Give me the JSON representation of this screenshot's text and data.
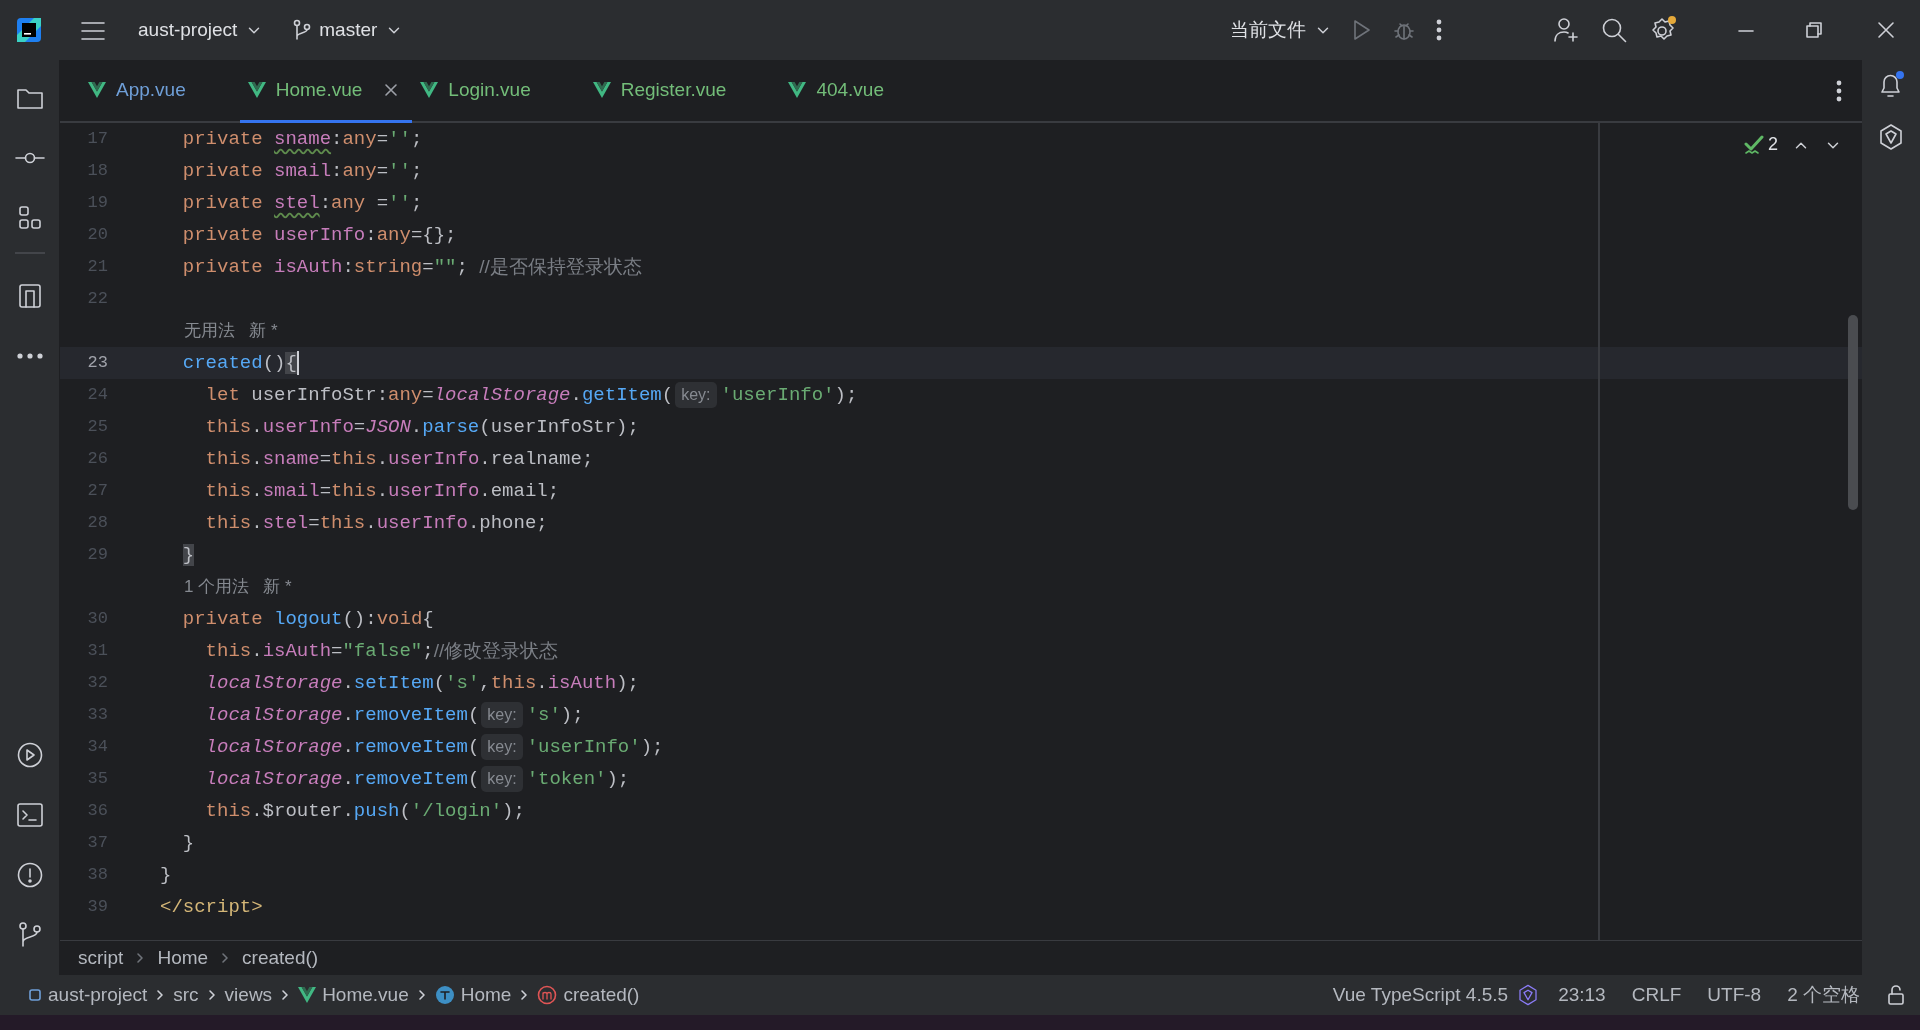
{
  "title_bar": {
    "project": "aust-project",
    "branch": "master",
    "run_config": "当前文件"
  },
  "tabs": [
    {
      "label": "App.vue",
      "selected": false,
      "color": "#6f9fd8"
    },
    {
      "label": "Home.vue",
      "selected": true,
      "color": "#73bd79"
    },
    {
      "label": "Login.vue",
      "selected": false,
      "color": "#73bd79"
    },
    {
      "label": "Register.vue",
      "selected": false,
      "color": "#73bd79"
    },
    {
      "label": "404.vue",
      "selected": false,
      "color": "#73bd79"
    }
  ],
  "editor": {
    "inspection_count": "2",
    "lines": [
      {
        "kind": "code",
        "number": "17",
        "current": false,
        "tokens": [
          {
            "kind": "kw",
            "text": "  private "
          },
          {
            "kind": "fieldw",
            "text": "sname"
          },
          {
            "kind": "plain",
            "text": ":"
          },
          {
            "kind": "kw",
            "text": "any"
          },
          {
            "kind": "plain",
            "text": "="
          },
          {
            "kind": "str",
            "text": "''"
          },
          {
            "kind": "plain",
            "text": ";"
          }
        ]
      },
      {
        "kind": "code",
        "number": "18",
        "current": false,
        "tokens": [
          {
            "kind": "kw",
            "text": "  private "
          },
          {
            "kind": "field",
            "text": "smail"
          },
          {
            "kind": "plain",
            "text": ":"
          },
          {
            "kind": "kw",
            "text": "any"
          },
          {
            "kind": "plain",
            "text": "="
          },
          {
            "kind": "str",
            "text": "''"
          },
          {
            "kind": "plain",
            "text": ";"
          }
        ]
      },
      {
        "kind": "code",
        "number": "19",
        "current": false,
        "tokens": [
          {
            "kind": "kw",
            "text": "  private "
          },
          {
            "kind": "fieldw",
            "text": "stel"
          },
          {
            "kind": "plain",
            "text": ":"
          },
          {
            "kind": "kw",
            "text": "any"
          },
          {
            "kind": "plain",
            "text": " ="
          },
          {
            "kind": "str",
            "text": "''"
          },
          {
            "kind": "plain",
            "text": ";"
          }
        ]
      },
      {
        "kind": "code",
        "number": "20",
        "current": false,
        "tokens": [
          {
            "kind": "kw",
            "text": "  private "
          },
          {
            "kind": "field",
            "text": "userInfo"
          },
          {
            "kind": "plain",
            "text": ":"
          },
          {
            "kind": "kw",
            "text": "any"
          },
          {
            "kind": "plain",
            "text": "={};"
          }
        ]
      },
      {
        "kind": "code",
        "number": "21",
        "current": false,
        "tokens": [
          {
            "kind": "kw",
            "text": "  private "
          },
          {
            "kind": "field",
            "text": "isAuth"
          },
          {
            "kind": "plain",
            "text": ":"
          },
          {
            "kind": "kw",
            "text": "string"
          },
          {
            "kind": "plain",
            "text": "="
          },
          {
            "kind": "str",
            "text": "\"\""
          },
          {
            "kind": "plain",
            "text": "; "
          },
          {
            "kind": "cmt",
            "text": "//是否保持登录状态"
          }
        ]
      },
      {
        "kind": "code",
        "number": "22",
        "current": false
      },
      {
        "kind": "lens",
        "text": "无用法   新 *"
      },
      {
        "kind": "code",
        "number": "23",
        "current": true,
        "tokens": [
          {
            "kind": "fn",
            "text": "  created"
          },
          {
            "kind": "plain",
            "text": "()"
          },
          {
            "kind": "brace",
            "text": "{"
          }
        ]
      },
      {
        "kind": "code",
        "number": "24",
        "current": false,
        "tokens": [
          {
            "kind": "kw",
            "text": "    let"
          },
          {
            "kind": "plain",
            "text": " userInfoStr:"
          },
          {
            "kind": "kw",
            "text": "any"
          },
          {
            "kind": "plain",
            "text": "="
          },
          {
            "kind": "glob",
            "text": "localStorage"
          },
          {
            "kind": "plain",
            "text": "."
          },
          {
            "kind": "fn",
            "text": "getItem"
          },
          {
            "kind": "plain",
            "text": "("
          },
          {
            "kind": "hint",
            "text": "key:"
          },
          {
            "kind": "str",
            "text": "'userInfo'"
          },
          {
            "kind": "plain",
            "text": ");"
          }
        ]
      },
      {
        "kind": "code",
        "number": "25",
        "current": false,
        "tokens": [
          {
            "kind": "kw",
            "text": "    this"
          },
          {
            "kind": "plain",
            "text": "."
          },
          {
            "kind": "field",
            "text": "userInfo"
          },
          {
            "kind": "plain",
            "text": "="
          },
          {
            "kind": "glob",
            "text": "JSON"
          },
          {
            "kind": "plain",
            "text": "."
          },
          {
            "kind": "fn",
            "text": "parse"
          },
          {
            "kind": "plain",
            "text": "(userInfoStr);"
          }
        ]
      },
      {
        "kind": "code",
        "number": "26",
        "current": false,
        "tokens": [
          {
            "kind": "kw",
            "text": "    this"
          },
          {
            "kind": "plain",
            "text": "."
          },
          {
            "kind": "field",
            "text": "sname"
          },
          {
            "kind": "plain",
            "text": "="
          },
          {
            "kind": "kw",
            "text": "this"
          },
          {
            "kind": "plain",
            "text": "."
          },
          {
            "kind": "field",
            "text": "userInfo"
          },
          {
            "kind": "plain",
            "text": ".realname;"
          }
        ]
      },
      {
        "kind": "code",
        "number": "27",
        "current": false,
        "tokens": [
          {
            "kind": "kw",
            "text": "    this"
          },
          {
            "kind": "plain",
            "text": "."
          },
          {
            "kind": "field",
            "text": "smail"
          },
          {
            "kind": "plain",
            "text": "="
          },
          {
            "kind": "kw",
            "text": "this"
          },
          {
            "kind": "plain",
            "text": "."
          },
          {
            "kind": "field",
            "text": "userInfo"
          },
          {
            "kind": "plain",
            "text": ".email;"
          }
        ]
      },
      {
        "kind": "code",
        "number": "28",
        "current": false,
        "tokens": [
          {
            "kind": "kw",
            "text": "    this"
          },
          {
            "kind": "plain",
            "text": "."
          },
          {
            "kind": "field",
            "text": "stel"
          },
          {
            "kind": "plain",
            "text": "="
          },
          {
            "kind": "kw",
            "text": "this"
          },
          {
            "kind": "plain",
            "text": "."
          },
          {
            "kind": "field",
            "text": "userInfo"
          },
          {
            "kind": "plain",
            "text": ".phone;"
          }
        ]
      },
      {
        "kind": "code",
        "number": "29",
        "current": false,
        "tokens": [
          {
            "kind": "brace",
            "text": "  }"
          }
        ]
      },
      {
        "kind": "lens",
        "text": "1 个用法   新 *"
      },
      {
        "kind": "code",
        "number": "30",
        "current": false,
        "tokens": [
          {
            "kind": "kw",
            "text": "  private "
          },
          {
            "kind": "fn",
            "text": "logout"
          },
          {
            "kind": "plain",
            "text": "():"
          },
          {
            "kind": "kw",
            "text": "void"
          },
          {
            "kind": "plain",
            "text": "{"
          }
        ]
      },
      {
        "kind": "code",
        "number": "31",
        "current": false,
        "tokens": [
          {
            "kind": "kw",
            "text": "    this"
          },
          {
            "kind": "plain",
            "text": "."
          },
          {
            "kind": "field",
            "text": "isAuth"
          },
          {
            "kind": "plain",
            "text": "="
          },
          {
            "kind": "str",
            "text": "\"false\""
          },
          {
            "kind": "plain",
            "text": ";"
          },
          {
            "kind": "cmt",
            "text": "//修改登录状态"
          }
        ]
      },
      {
        "kind": "code",
        "number": "32",
        "current": false,
        "tokens": [
          {
            "kind": "glob",
            "text": "    localStorage"
          },
          {
            "kind": "plain",
            "text": "."
          },
          {
            "kind": "fn",
            "text": "setItem"
          },
          {
            "kind": "plain",
            "text": "("
          },
          {
            "kind": "str",
            "text": "'s'"
          },
          {
            "kind": "plain",
            "text": ","
          },
          {
            "kind": "kw",
            "text": "this"
          },
          {
            "kind": "plain",
            "text": "."
          },
          {
            "kind": "field",
            "text": "isAuth"
          },
          {
            "kind": "plain",
            "text": ");"
          }
        ]
      },
      {
        "kind": "code",
        "number": "33",
        "current": false,
        "tokens": [
          {
            "kind": "glob",
            "text": "    localStorage"
          },
          {
            "kind": "plain",
            "text": "."
          },
          {
            "kind": "fn",
            "text": "removeItem"
          },
          {
            "kind": "plain",
            "text": "("
          },
          {
            "kind": "hint",
            "text": "key:"
          },
          {
            "kind": "str",
            "text": "'s'"
          },
          {
            "kind": "plain",
            "text": ");"
          }
        ]
      },
      {
        "kind": "code",
        "number": "34",
        "current": false,
        "tokens": [
          {
            "kind": "glob",
            "text": "    localStorage"
          },
          {
            "kind": "plain",
            "text": "."
          },
          {
            "kind": "fn",
            "text": "removeItem"
          },
          {
            "kind": "plain",
            "text": "("
          },
          {
            "kind": "hint",
            "text": "key:"
          },
          {
            "kind": "str",
            "text": "'userInfo'"
          },
          {
            "kind": "plain",
            "text": ");"
          }
        ]
      },
      {
        "kind": "code",
        "number": "35",
        "current": false,
        "tokens": [
          {
            "kind": "glob",
            "text": "    localStorage"
          },
          {
            "kind": "plain",
            "text": "."
          },
          {
            "kind": "fn",
            "text": "removeItem"
          },
          {
            "kind": "plain",
            "text": "("
          },
          {
            "kind": "hint",
            "text": "key:"
          },
          {
            "kind": "str",
            "text": "'token'"
          },
          {
            "kind": "plain",
            "text": ");"
          }
        ]
      },
      {
        "kind": "code",
        "number": "36",
        "current": false,
        "tokens": [
          {
            "kind": "kw",
            "text": "    this"
          },
          {
            "kind": "plain",
            "text": ".$router."
          },
          {
            "kind": "fn",
            "text": "push"
          },
          {
            "kind": "plain",
            "text": "("
          },
          {
            "kind": "str",
            "text": "'/login'"
          },
          {
            "kind": "plain",
            "text": ");"
          }
        ]
      },
      {
        "kind": "code",
        "number": "37",
        "current": false,
        "tokens": [
          {
            "kind": "plain",
            "text": "  }"
          }
        ]
      },
      {
        "kind": "code",
        "number": "38",
        "current": false,
        "tokens": [
          {
            "kind": "plain",
            "text": "}"
          }
        ]
      },
      {
        "kind": "code",
        "number": "39",
        "current": false,
        "tokens": [
          {
            "kind": "tag",
            "text": "</script>"
          }
        ]
      }
    ]
  },
  "breadcrumbs": [
    "script",
    "Home",
    "created()"
  ],
  "status_bar": {
    "path": [
      {
        "kind": "project",
        "label": "aust-project"
      },
      {
        "kind": "folder",
        "label": "src"
      },
      {
        "kind": "folder",
        "label": "views"
      },
      {
        "kind": "vue",
        "label": "Home.vue"
      },
      {
        "kind": "class",
        "label": "Home"
      },
      {
        "kind": "method",
        "label": "created()"
      }
    ],
    "language": "Vue TypeScript 4.5.5",
    "position": "23:13",
    "line_ending": "CRLF",
    "encoding": "UTF-8",
    "indent": "2 个空格"
  }
}
